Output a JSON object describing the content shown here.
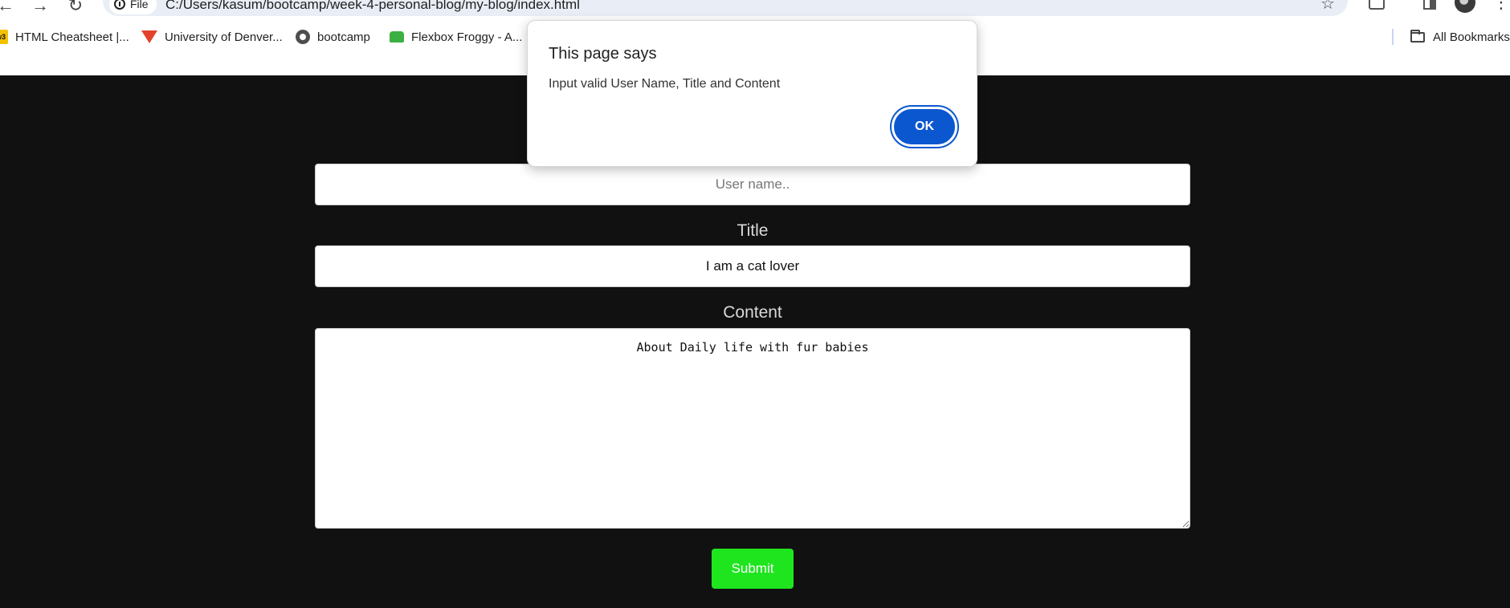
{
  "browser": {
    "site_chip_label": "File",
    "url": "C:/Users/kasum/bootcamp/week-4-personal-blog/my-blog/index.html",
    "bookmarks": [
      {
        "label": "HTML Cheatsheet |...",
        "icon": "w3schools-icon"
      },
      {
        "label": "University of Denver...",
        "icon": "gitlab-icon"
      },
      {
        "label": "bootcamp",
        "icon": "globe-icon"
      },
      {
        "label": "Flexbox Froggy - A...",
        "icon": "frog-icon"
      }
    ],
    "all_bookmarks_label": "All Bookmarks"
  },
  "form": {
    "username_placeholder": "User name..",
    "username_value": "",
    "title_label": "Title",
    "title_value": "I am a cat lover",
    "content_label": "Content",
    "content_value": "About Daily life with fur babies",
    "submit_label": "Submit"
  },
  "alert": {
    "title": "This page says",
    "message": "Input valid User Name, Title and Content",
    "ok_label": "OK"
  },
  "colors": {
    "page_background": "#111111",
    "submit_button": "#1ee51e",
    "ok_button": "#0b57d0"
  }
}
